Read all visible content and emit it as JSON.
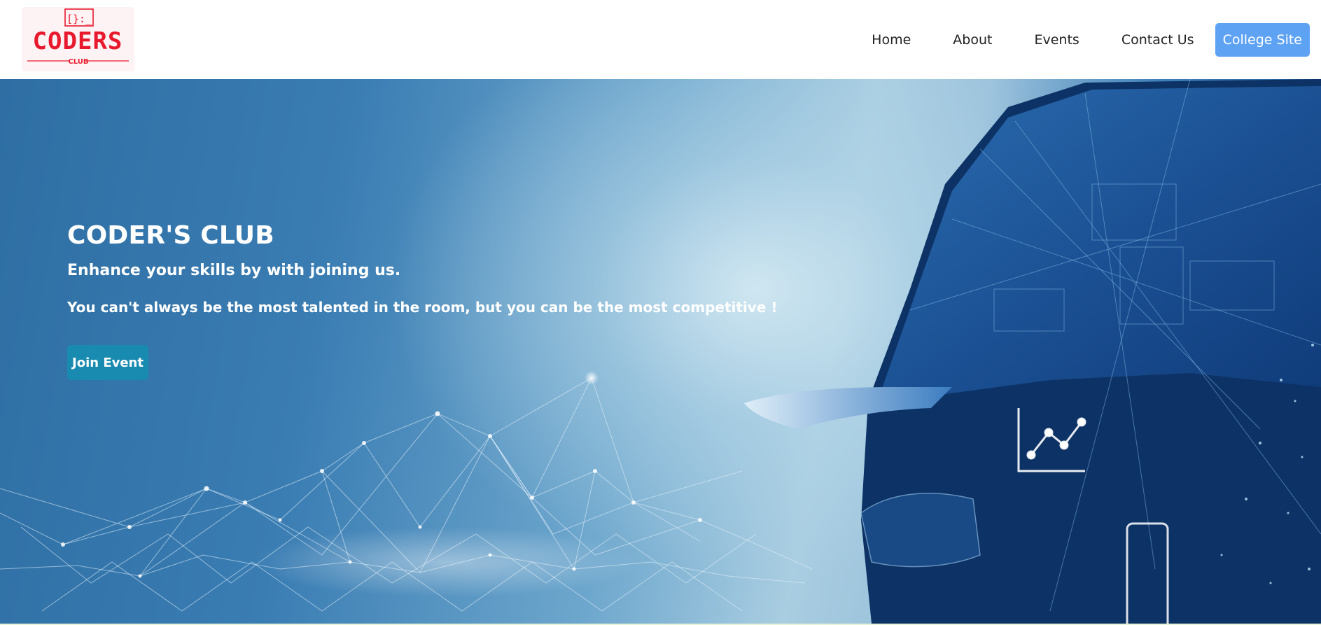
{
  "brand": {
    "logo_icon_text": "[}:_",
    "logo_title": "CODERS",
    "logo_subtitle": "CLUB",
    "logo_color": "#e8192c"
  },
  "nav": {
    "items": [
      {
        "label": "Home"
      },
      {
        "label": "About"
      },
      {
        "label": "Events"
      },
      {
        "label": "Contact Us"
      }
    ],
    "cta_label": "College Site",
    "cta_color": "#5ea2f4"
  },
  "hero": {
    "title": "CODER'S CLUB",
    "subtitle": "Enhance your skills by with joining us.",
    "quote": "You can't always be the most talented in the room, but you can be the most competitive !",
    "button_label": "Join Event",
    "button_color": "#1a8bb0",
    "background_image": "technology-network-helmet-illustration"
  }
}
